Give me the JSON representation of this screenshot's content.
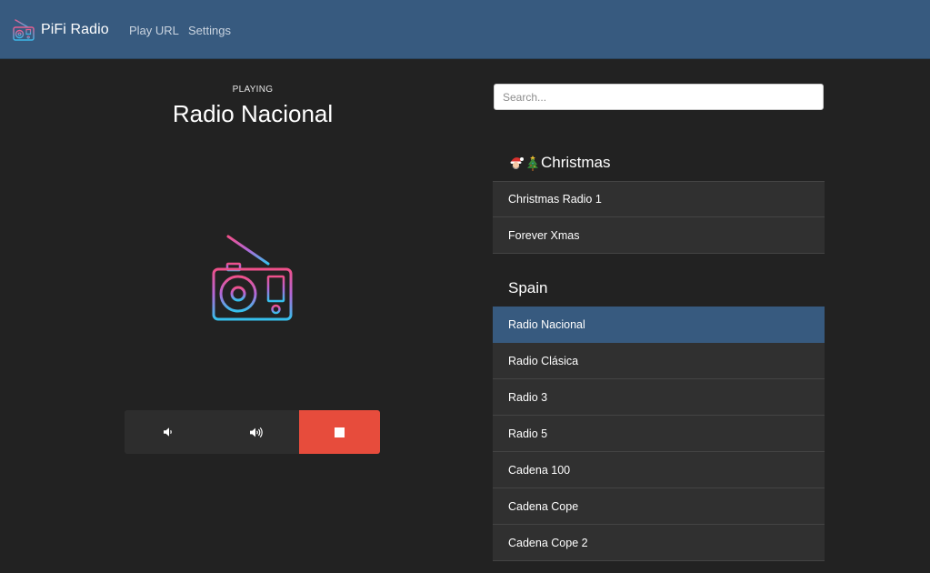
{
  "navbar": {
    "brand": "PiFi Radio",
    "links": [
      "Play URL",
      "Settings"
    ]
  },
  "player": {
    "status_label": "PLAYING",
    "station": "Radio Nacional",
    "controls": {
      "volume_down_icon": "volume-down-icon",
      "volume_up_icon": "volume-up-icon",
      "stop_icon": "stop-icon"
    }
  },
  "search": {
    "placeholder": "Search...",
    "value": ""
  },
  "groups": [
    {
      "title": "Christmas",
      "emoji_icons": [
        "santa-emoji-icon",
        "christmas-tree-emoji-icon"
      ],
      "stations": [
        "Christmas Radio 1",
        "Forever Xmas"
      ]
    },
    {
      "title": "Spain",
      "stations": [
        "Radio Nacional",
        "Radio Clásica",
        "Radio 3",
        "Radio 5",
        "Cadena 100",
        "Cadena Cope",
        "Cadena Cope 2"
      ],
      "active_station": "Radio Nacional"
    }
  ],
  "colors": {
    "navbar": "#375a7f",
    "background": "#222222",
    "list_item": "#303030",
    "active_item": "#375a7f",
    "stop_button": "#e74c3c"
  }
}
